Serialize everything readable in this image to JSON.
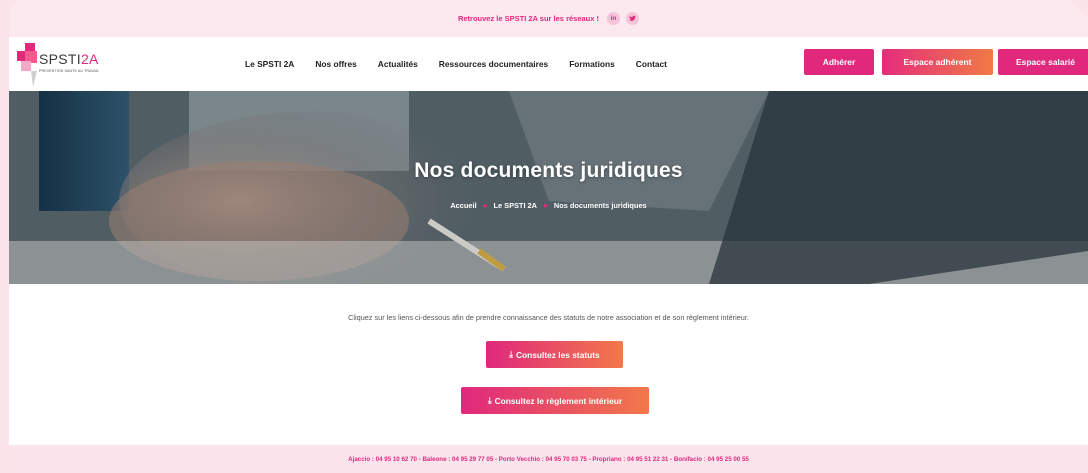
{
  "topbar": {
    "text": "Retrouvez le SPSTI 2A sur les réseaux !",
    "social": [
      {
        "icon": "linkedin-icon",
        "glyph": "in"
      },
      {
        "icon": "twitter-icon",
        "glyph": "🐦"
      }
    ]
  },
  "brand": {
    "name_main": "SPSTI",
    "name_accent": "2A",
    "tagline": "PREVENTION SANTE AU TRAVAIL"
  },
  "nav": {
    "items": [
      "Le SPSTI 2A",
      "Nos offres",
      "Actualités",
      "Ressources documentaires",
      "Formations",
      "Contact"
    ],
    "buttons": {
      "adherer": "Adhérer",
      "espace_adherent": "Espace adhérent",
      "espace_salarie": "Espace salarié"
    }
  },
  "hero": {
    "title": "Nos documents juridiques",
    "breadcrumb": [
      "Accueil",
      "Le SPSTI 2A",
      "Nos documents juridiques"
    ]
  },
  "content": {
    "intro": "Cliquez sur les liens ci-dessous afin de prendre connaissance des statuts de notre association et de son règlement intérieur.",
    "buttons": {
      "statuts": "Consultez les statuts",
      "reglement": "Consultez le règlement intérieur"
    }
  },
  "footer": {
    "text": "Ajaccio : 04 95 10 62 70 - Baleone : 04 95 29 77 05 - Porto Vecchio : 04 95 70 03 75 - Propriano : 04 95 51 22 31 - Bonifacio : 04 95 25 00 55"
  },
  "colors": {
    "brand_pink": "#e0287d",
    "brand_orange": "#f2784a",
    "topbar_bg": "#fce8ef"
  }
}
